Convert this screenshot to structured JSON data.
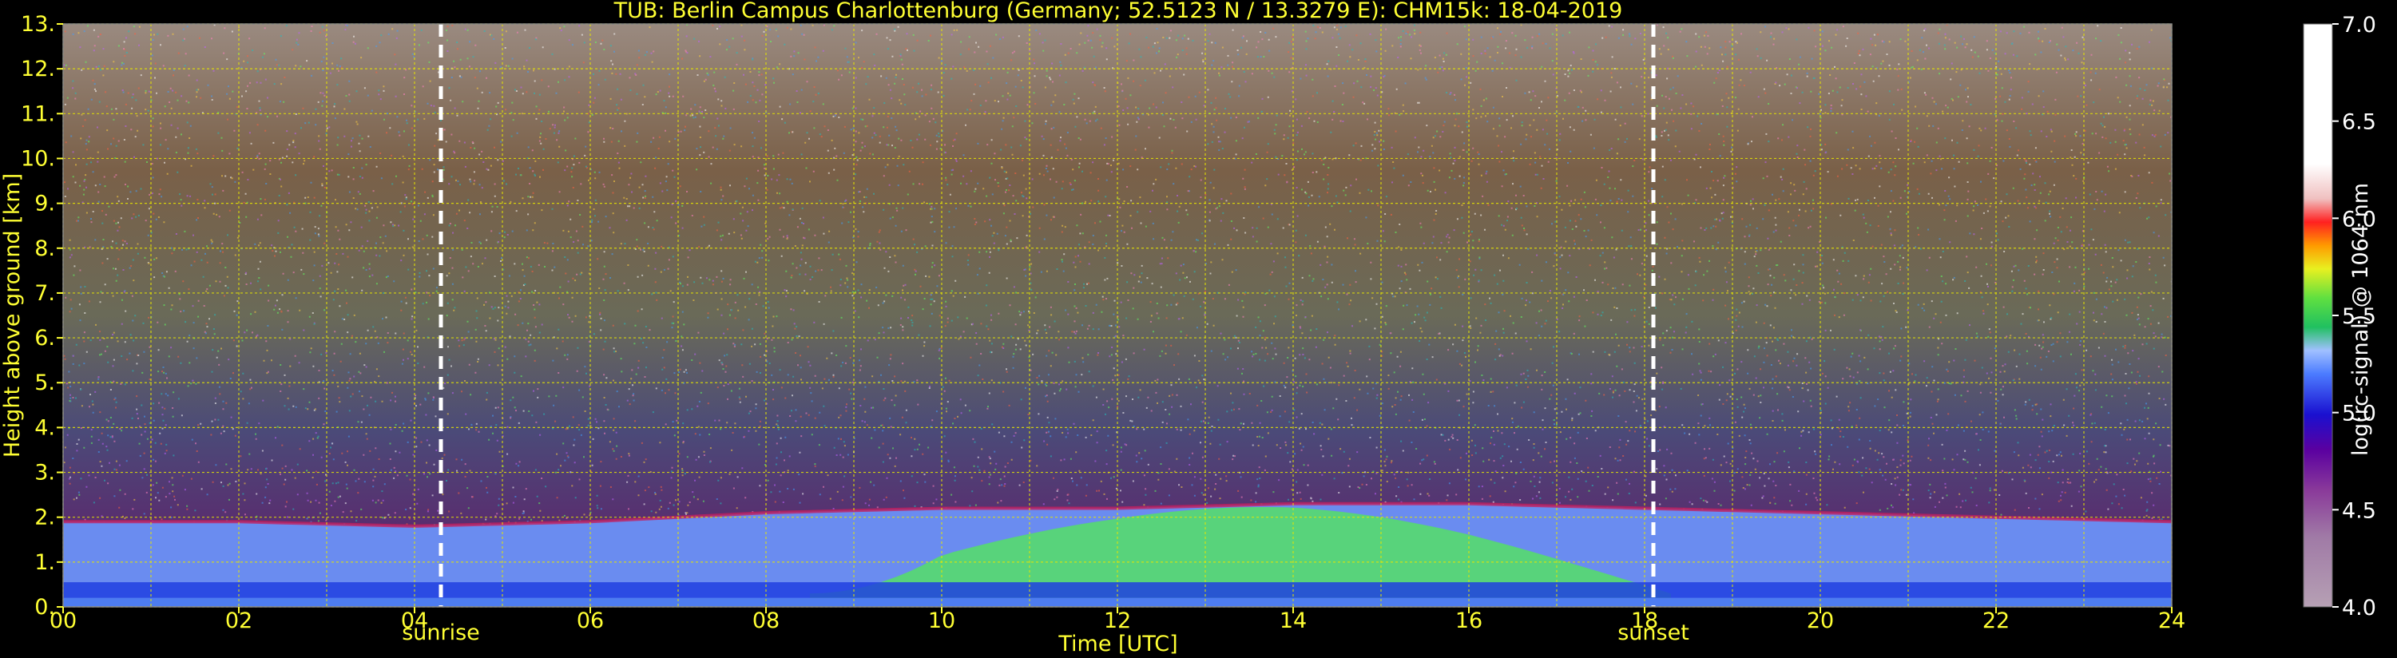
{
  "chart_data": {
    "type": "heatmap",
    "title": "TUB: Berlin Campus Charlottenburg (Germany; 52.5123 N / 13.3279 E):    CHM15k: 18-04-2019",
    "xlabel": "Time [UTC]",
    "ylabel": "Height above ground [km]",
    "xlim": [
      0,
      24
    ],
    "ylim": [
      0,
      13
    ],
    "x_ticks": [
      "00",
      "02",
      "04",
      "06",
      "08",
      "10",
      "12",
      "14",
      "16",
      "18",
      "20",
      "22",
      "24"
    ],
    "y_ticks": [
      "0.",
      "1.",
      "2.",
      "3.",
      "4.",
      "5.",
      "6.",
      "7.",
      "8.",
      "9.",
      "10.",
      "11.",
      "12.",
      "13."
    ],
    "grid": true,
    "colorbar": {
      "label": "log(rc-signal) @ 1064 nm",
      "range": [
        4.0,
        7.0
      ],
      "ticks": [
        "4.0",
        "4.5",
        "5.0",
        "5.5",
        "6.0",
        "6.5",
        "7.0"
      ]
    },
    "annotations": [
      {
        "label": "sunrise",
        "time": 4.3
      },
      {
        "label": "sunset",
        "time": 18.1
      }
    ],
    "boundary_layer_top_km": [
      {
        "t": 0,
        "h": 1.9
      },
      {
        "t": 2,
        "h": 1.9
      },
      {
        "t": 4,
        "h": 1.8
      },
      {
        "t": 6,
        "h": 1.9
      },
      {
        "t": 8,
        "h": 2.1
      },
      {
        "t": 10,
        "h": 2.2
      },
      {
        "t": 12,
        "h": 2.2
      },
      {
        "t": 14,
        "h": 2.3
      },
      {
        "t": 16,
        "h": 2.3
      },
      {
        "t": 18,
        "h": 2.2
      },
      {
        "t": 20,
        "h": 2.1
      },
      {
        "t": 22,
        "h": 2.0
      },
      {
        "t": 24,
        "h": 1.9
      }
    ]
  },
  "colors": {
    "text": "#ffff33",
    "background": "#000000",
    "grid": "#e6e600",
    "marker": "#ffffff"
  }
}
